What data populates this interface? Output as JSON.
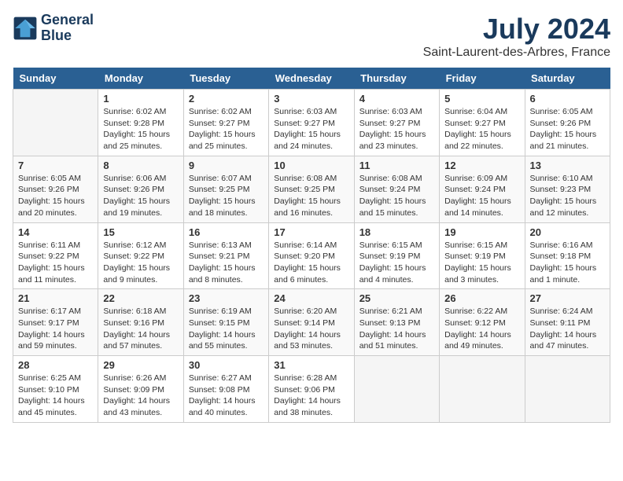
{
  "logo": {
    "line1": "General",
    "line2": "Blue"
  },
  "title": "July 2024",
  "subtitle": "Saint-Laurent-des-Arbres, France",
  "headers": [
    "Sunday",
    "Monday",
    "Tuesday",
    "Wednesday",
    "Thursday",
    "Friday",
    "Saturday"
  ],
  "weeks": [
    [
      {
        "day": "",
        "content": ""
      },
      {
        "day": "1",
        "content": "Sunrise: 6:02 AM\nSunset: 9:28 PM\nDaylight: 15 hours\nand 25 minutes."
      },
      {
        "day": "2",
        "content": "Sunrise: 6:02 AM\nSunset: 9:27 PM\nDaylight: 15 hours\nand 25 minutes."
      },
      {
        "day": "3",
        "content": "Sunrise: 6:03 AM\nSunset: 9:27 PM\nDaylight: 15 hours\nand 24 minutes."
      },
      {
        "day": "4",
        "content": "Sunrise: 6:03 AM\nSunset: 9:27 PM\nDaylight: 15 hours\nand 23 minutes."
      },
      {
        "day": "5",
        "content": "Sunrise: 6:04 AM\nSunset: 9:27 PM\nDaylight: 15 hours\nand 22 minutes."
      },
      {
        "day": "6",
        "content": "Sunrise: 6:05 AM\nSunset: 9:26 PM\nDaylight: 15 hours\nand 21 minutes."
      }
    ],
    [
      {
        "day": "7",
        "content": "Sunrise: 6:05 AM\nSunset: 9:26 PM\nDaylight: 15 hours\nand 20 minutes."
      },
      {
        "day": "8",
        "content": "Sunrise: 6:06 AM\nSunset: 9:26 PM\nDaylight: 15 hours\nand 19 minutes."
      },
      {
        "day": "9",
        "content": "Sunrise: 6:07 AM\nSunset: 9:25 PM\nDaylight: 15 hours\nand 18 minutes."
      },
      {
        "day": "10",
        "content": "Sunrise: 6:08 AM\nSunset: 9:25 PM\nDaylight: 15 hours\nand 16 minutes."
      },
      {
        "day": "11",
        "content": "Sunrise: 6:08 AM\nSunset: 9:24 PM\nDaylight: 15 hours\nand 15 minutes."
      },
      {
        "day": "12",
        "content": "Sunrise: 6:09 AM\nSunset: 9:24 PM\nDaylight: 15 hours\nand 14 minutes."
      },
      {
        "day": "13",
        "content": "Sunrise: 6:10 AM\nSunset: 9:23 PM\nDaylight: 15 hours\nand 12 minutes."
      }
    ],
    [
      {
        "day": "14",
        "content": "Sunrise: 6:11 AM\nSunset: 9:22 PM\nDaylight: 15 hours\nand 11 minutes."
      },
      {
        "day": "15",
        "content": "Sunrise: 6:12 AM\nSunset: 9:22 PM\nDaylight: 15 hours\nand 9 minutes."
      },
      {
        "day": "16",
        "content": "Sunrise: 6:13 AM\nSunset: 9:21 PM\nDaylight: 15 hours\nand 8 minutes."
      },
      {
        "day": "17",
        "content": "Sunrise: 6:14 AM\nSunset: 9:20 PM\nDaylight: 15 hours\nand 6 minutes."
      },
      {
        "day": "18",
        "content": "Sunrise: 6:15 AM\nSunset: 9:19 PM\nDaylight: 15 hours\nand 4 minutes."
      },
      {
        "day": "19",
        "content": "Sunrise: 6:15 AM\nSunset: 9:19 PM\nDaylight: 15 hours\nand 3 minutes."
      },
      {
        "day": "20",
        "content": "Sunrise: 6:16 AM\nSunset: 9:18 PM\nDaylight: 15 hours\nand 1 minute."
      }
    ],
    [
      {
        "day": "21",
        "content": "Sunrise: 6:17 AM\nSunset: 9:17 PM\nDaylight: 14 hours\nand 59 minutes."
      },
      {
        "day": "22",
        "content": "Sunrise: 6:18 AM\nSunset: 9:16 PM\nDaylight: 14 hours\nand 57 minutes."
      },
      {
        "day": "23",
        "content": "Sunrise: 6:19 AM\nSunset: 9:15 PM\nDaylight: 14 hours\nand 55 minutes."
      },
      {
        "day": "24",
        "content": "Sunrise: 6:20 AM\nSunset: 9:14 PM\nDaylight: 14 hours\nand 53 minutes."
      },
      {
        "day": "25",
        "content": "Sunrise: 6:21 AM\nSunset: 9:13 PM\nDaylight: 14 hours\nand 51 minutes."
      },
      {
        "day": "26",
        "content": "Sunrise: 6:22 AM\nSunset: 9:12 PM\nDaylight: 14 hours\nand 49 minutes."
      },
      {
        "day": "27",
        "content": "Sunrise: 6:24 AM\nSunset: 9:11 PM\nDaylight: 14 hours\nand 47 minutes."
      }
    ],
    [
      {
        "day": "28",
        "content": "Sunrise: 6:25 AM\nSunset: 9:10 PM\nDaylight: 14 hours\nand 45 minutes."
      },
      {
        "day": "29",
        "content": "Sunrise: 6:26 AM\nSunset: 9:09 PM\nDaylight: 14 hours\nand 43 minutes."
      },
      {
        "day": "30",
        "content": "Sunrise: 6:27 AM\nSunset: 9:08 PM\nDaylight: 14 hours\nand 40 minutes."
      },
      {
        "day": "31",
        "content": "Sunrise: 6:28 AM\nSunset: 9:06 PM\nDaylight: 14 hours\nand 38 minutes."
      },
      {
        "day": "",
        "content": ""
      },
      {
        "day": "",
        "content": ""
      },
      {
        "day": "",
        "content": ""
      }
    ]
  ]
}
